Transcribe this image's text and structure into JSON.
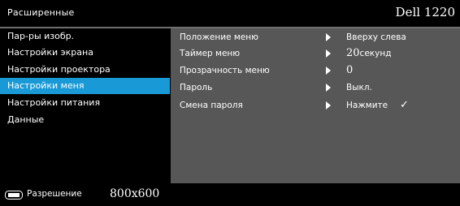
{
  "header": {
    "title": "Расширенные",
    "brand": "Dell 1220"
  },
  "sidebar": {
    "items": [
      {
        "label": "Пар-ры изобр."
      },
      {
        "label": "Настройки экрана"
      },
      {
        "label": "Настройки проектора"
      },
      {
        "label": "Настройки меня",
        "active": true
      },
      {
        "label": "Настройки питания"
      },
      {
        "label": "Данные"
      }
    ]
  },
  "panel": {
    "rows": [
      {
        "label": "Положение меню",
        "value": "Вверху слева"
      },
      {
        "label": "Таймер меню",
        "value_num": "20",
        "value_unit": "секунд"
      },
      {
        "label": "Прозрачность меню",
        "value_num": "0"
      },
      {
        "label": "Пароль",
        "value": "Выкл."
      },
      {
        "label": "Смена пароля",
        "value": "Нажмите",
        "check": "✓"
      }
    ]
  },
  "footer": {
    "icon": "keyboard-icon",
    "label": "Разрешение",
    "value": "800x600"
  },
  "colors": {
    "accent": "#199ad6",
    "panel": "#575757",
    "background": "#000000"
  }
}
